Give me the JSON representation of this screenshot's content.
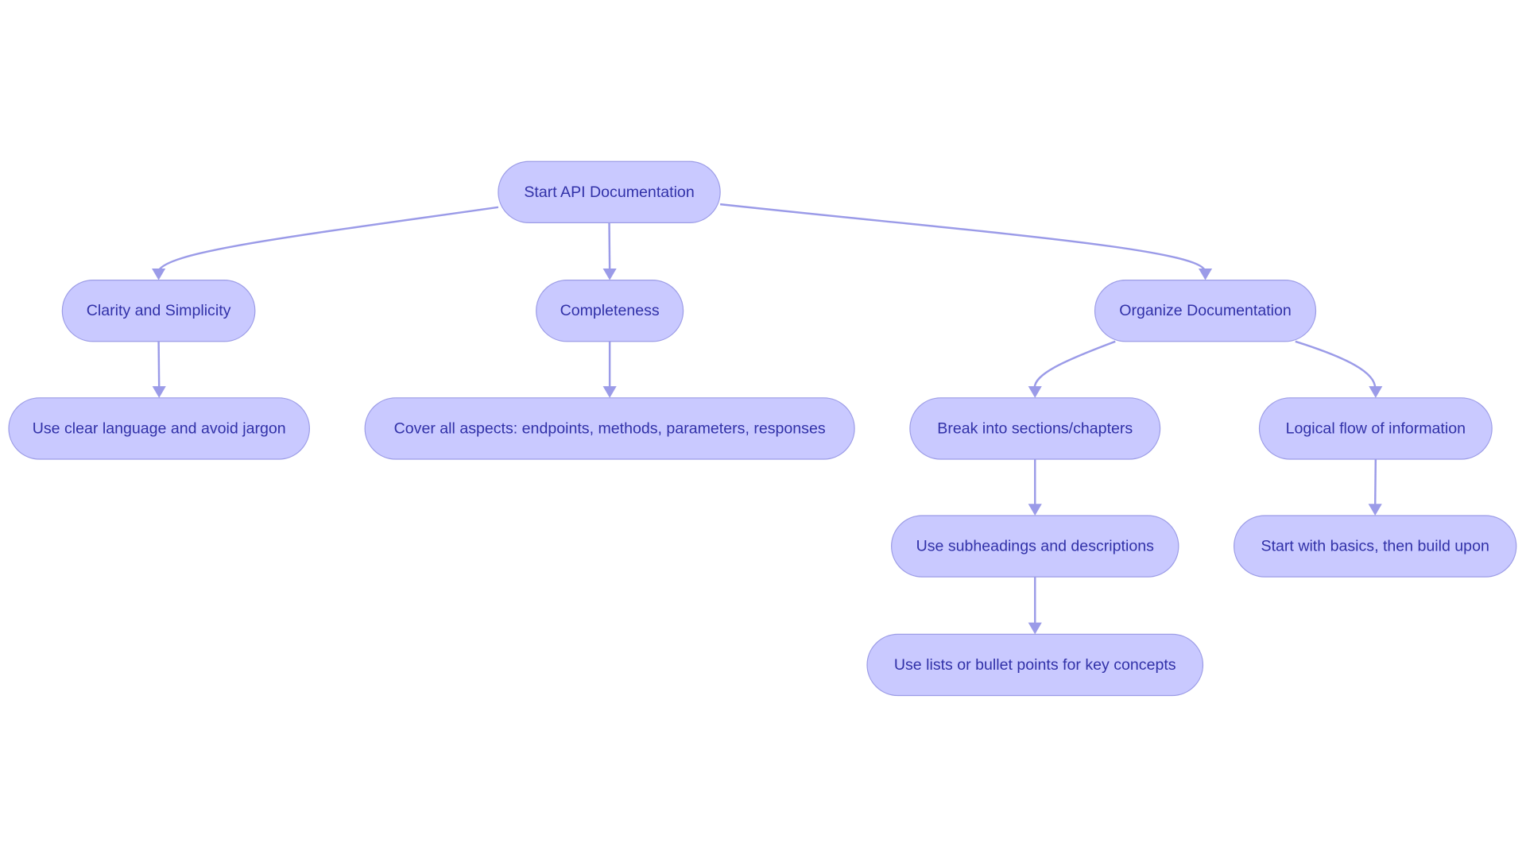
{
  "diagram": {
    "type": "flowchart",
    "direction": "top-down",
    "colors": {
      "node_fill": "#c9c9ff",
      "node_stroke": "#9c9ce6",
      "text": "#3131a8",
      "edge": "#9b9be8"
    },
    "nodes": [
      {
        "id": "root",
        "label": "Start API Documentation"
      },
      {
        "id": "clarity",
        "label": "Clarity and Simplicity"
      },
      {
        "id": "completeness",
        "label": "Completeness"
      },
      {
        "id": "organize",
        "label": "Organize Documentation"
      },
      {
        "id": "clear",
        "label": "Use clear language and avoid jargon"
      },
      {
        "id": "cover",
        "label": "Cover all aspects: endpoints, methods, parameters, responses"
      },
      {
        "id": "break",
        "label": "Break into sections/chapters"
      },
      {
        "id": "logical",
        "label": "Logical flow of information"
      },
      {
        "id": "subheadings",
        "label": "Use subheadings and descriptions"
      },
      {
        "id": "basics",
        "label": "Start with basics, then build upon"
      },
      {
        "id": "lists",
        "label": "Use lists or bullet points for key concepts"
      }
    ],
    "edges": [
      {
        "from": "root",
        "to": "clarity"
      },
      {
        "from": "root",
        "to": "completeness"
      },
      {
        "from": "root",
        "to": "organize"
      },
      {
        "from": "clarity",
        "to": "clear"
      },
      {
        "from": "completeness",
        "to": "cover"
      },
      {
        "from": "organize",
        "to": "break"
      },
      {
        "from": "organize",
        "to": "logical"
      },
      {
        "from": "break",
        "to": "subheadings"
      },
      {
        "from": "logical",
        "to": "basics"
      },
      {
        "from": "subheadings",
        "to": "lists"
      }
    ]
  }
}
